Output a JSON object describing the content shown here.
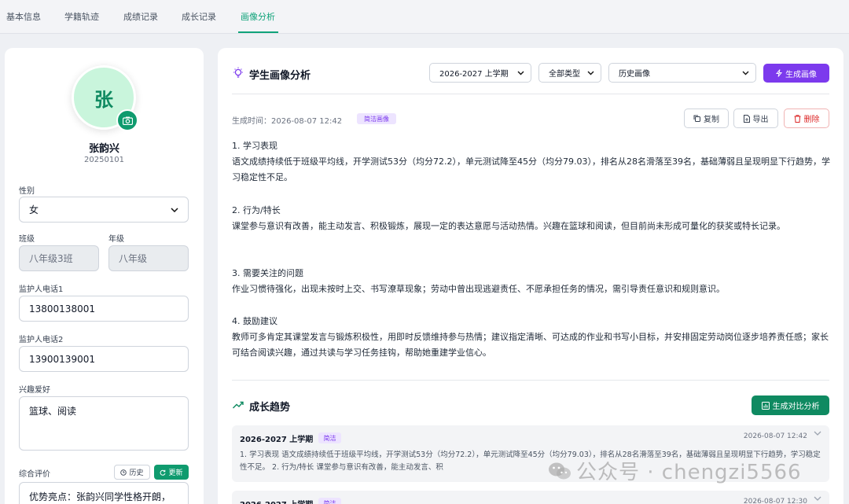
{
  "tabs": [
    {
      "label": "基本信息",
      "active": false
    },
    {
      "label": "学籍轨迹",
      "active": false
    },
    {
      "label": "成绩记录",
      "active": false
    },
    {
      "label": "成长记录",
      "active": false
    },
    {
      "label": "画像分析",
      "active": true
    }
  ],
  "profile": {
    "avatar_char": "张",
    "name": "张韵兴",
    "student_id": "20250101"
  },
  "form": {
    "gender_label": "性别",
    "gender_value": "女",
    "class_label": "班级",
    "class_value": "八年级3班",
    "grade_label": "年级",
    "grade_value": "八年级",
    "guardian1_label": "监护人电话1",
    "guardian1_value": "13800138001",
    "guardian2_label": "监护人电话2",
    "guardian2_value": "13900139001",
    "hobby_label": "兴趣爱好",
    "hobby_value": "篮球、阅读",
    "eval_label": "综合评价",
    "eval_history_btn": "历史",
    "eval_update_btn": "更新",
    "eval_value": "优势亮点：张韵兴同学性格开朗，"
  },
  "analysis": {
    "title": "学生画像分析",
    "semester_select": "2026-2027 上学期",
    "type_select": "全部类型",
    "history_select": "历史画像",
    "generate_btn": "生成画像",
    "gen_time": "生成时间：2026-08-07 12:42",
    "badge": "简洁画像",
    "copy_btn": "复制",
    "export_btn": "导出",
    "delete_btn": "删除",
    "sections": [
      {
        "heading": "1. 学习表现",
        "body": "语文成绩持续低于班级平均线，开学测试53分（均分72.2），单元测试降至45分（均分79.03），排名从28名滑落至39名，基础薄弱且呈现明显下行趋势，学习稳定性不足。"
      },
      {
        "heading": "2. 行为/特长",
        "body": "课堂参与意识有改善，能主动发言、积极锻炼，展现一定的表达意愿与活动热情。兴趣在篮球和阅读，但目前尚未形成可量化的获奖或特长记录。"
      },
      {
        "heading": "3. 需要关注的问题",
        "body": "作业习惯待强化，出现未按时上交、书写潦草现象；劳动中曾出现逃避责任、不愿承担任务的情况，需引导责任意识和规则意识。"
      },
      {
        "heading": "4. 鼓励建议",
        "body": "教师可多肯定其课堂发言与锻炼积极性，用即时反馈维持参与热情；建议指定清晰、可达成的作业和书写小目标，并安排固定劳动岗位逐步培养责任感；家长可结合阅读兴趣，通过共读与学习任务挂钩，帮助她重建学业信心。"
      }
    ]
  },
  "trend": {
    "title": "成长趋势",
    "compare_btn": "生成对比分析",
    "cards": [
      {
        "semester": "2026-2027 上学期",
        "badge": "简洁",
        "time": "2026-08-07 12:42",
        "body": "1. 学习表现 语文成绩持续低于班级平均线，开学测试53分（均分72.2），单元测试降至45分（均分79.03），排名从28名滑落至39名，基础薄弱且呈现明显下行趋势，学习稳定性不足。 2. 行为/特长 课堂参与意识有改善，能主动发言、积"
      },
      {
        "semester": "2026-2027 上学期",
        "badge": "简洁",
        "time": "2026-08-07 12:30",
        "body": ""
      }
    ]
  },
  "watermark": "公众号 · chengzi5566",
  "colors": {
    "accent_green": "#10a37a",
    "accent_purple": "#7c3aed",
    "danger": "#dc2626"
  }
}
